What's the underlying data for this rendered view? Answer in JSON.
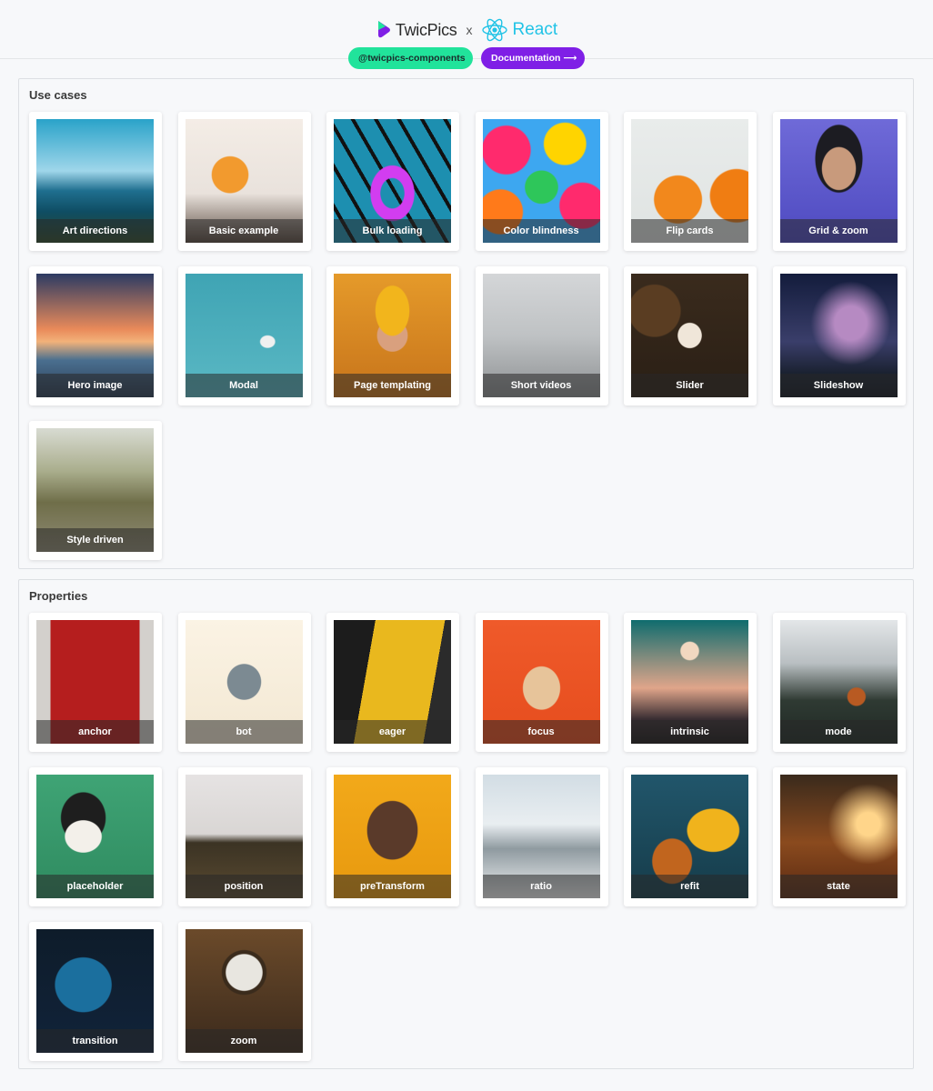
{
  "header": {
    "brand_left": "TwicPics",
    "separator": "x",
    "brand_right": "React",
    "chip_package": "@twicpics-components",
    "chip_docs": "Documentation ⟶",
    "colors": {
      "twic_accent": "#7f1fe6",
      "react_blue": "#21c3e6",
      "chip_green": "#21e39b"
    }
  },
  "use_cases": {
    "title": "Use cases",
    "items": [
      {
        "label": "Art directions",
        "icon": "seascape-photo"
      },
      {
        "label": "Basic example",
        "icon": "football-player-photo"
      },
      {
        "label": "Bulk loading",
        "icon": "pool-ring-photo"
      },
      {
        "label": "Color blindness",
        "icon": "umbrellas-photo"
      },
      {
        "label": "Flip cards",
        "icon": "oranges-photo"
      },
      {
        "label": "Grid & zoom",
        "icon": "portrait-photo"
      },
      {
        "label": "Hero image",
        "icon": "golden-gate-photo"
      },
      {
        "label": "Modal",
        "icon": "seagull-photo"
      },
      {
        "label": "Page templating",
        "icon": "woman-beanie-photo"
      },
      {
        "label": "Short videos",
        "icon": "skateboard-photo"
      },
      {
        "label": "Slider",
        "icon": "pantone-leaves-photo"
      },
      {
        "label": "Slideshow",
        "icon": "milky-way-photo"
      },
      {
        "label": "Style driven",
        "icon": "horse-road-photo"
      }
    ]
  },
  "properties": {
    "title": "Properties",
    "items": [
      {
        "label": "anchor",
        "icon": "red-door-photo"
      },
      {
        "label": "bot",
        "icon": "toy-robot-photo"
      },
      {
        "label": "eager",
        "icon": "yellow-train-photo"
      },
      {
        "label": "focus",
        "icon": "corgi-photo"
      },
      {
        "label": "intrinsic",
        "icon": "moon-sunset-photo"
      },
      {
        "label": "mode",
        "icon": "fox-mountains-photo"
      },
      {
        "label": "placeholder",
        "icon": "cat-photo"
      },
      {
        "label": "position",
        "icon": "horse-field-photo"
      },
      {
        "label": "preTransform",
        "icon": "hands-face-photo"
      },
      {
        "label": "ratio",
        "icon": "snow-walk-photo"
      },
      {
        "label": "refit",
        "icon": "dog-yellow-coat-photo"
      },
      {
        "label": "state",
        "icon": "forest-sunlight-photo"
      },
      {
        "label": "transition",
        "icon": "peacock-photo"
      },
      {
        "label": "zoom",
        "icon": "magnifier-stamps-photo"
      }
    ]
  }
}
